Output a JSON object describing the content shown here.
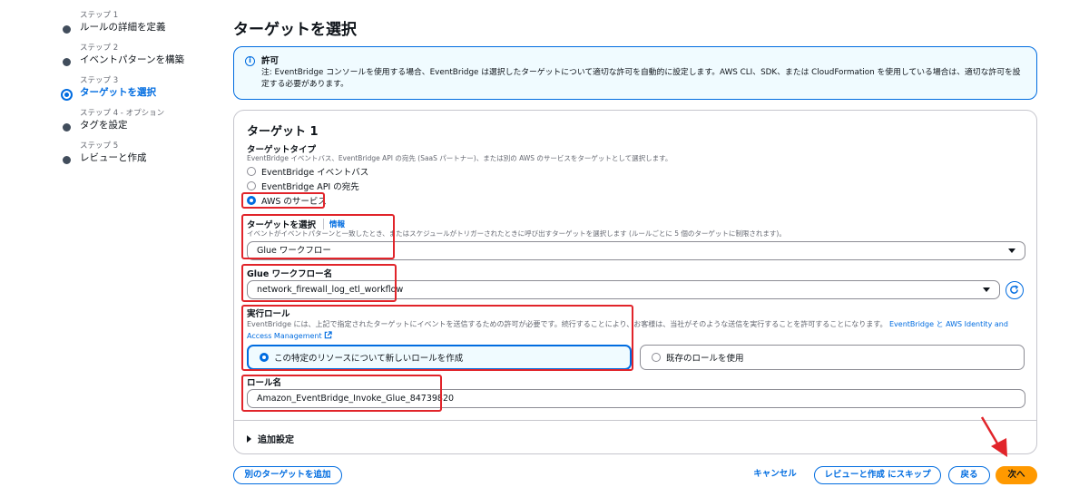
{
  "sidebar": {
    "steps": [
      {
        "label": "ステップ 1",
        "name": "ルールの詳細を定義"
      },
      {
        "label": "ステップ 2",
        "name": "イベントパターンを構築"
      },
      {
        "label": "ステップ 3",
        "name": "ターゲットを選択"
      },
      {
        "label": "ステップ 4 - オプション",
        "name": "タグを設定"
      },
      {
        "label": "ステップ 5",
        "name": "レビューと作成"
      }
    ]
  },
  "page_title": "ターゲットを選択",
  "alert": {
    "title": "許可",
    "body": "注: EventBridge コンソールを使用する場合、EventBridge は選択したターゲットについて適切な許可を自動的に設定します。AWS CLI、SDK、または CloudFormation を使用している場合は、適切な許可を設定する必要があります。"
  },
  "target": {
    "heading": "ターゲット 1",
    "type_label": "ターゲットタイプ",
    "type_desc": "EventBridge イベントバス、EventBridge API の宛先 (SaaS パートナー)、または別の AWS のサービスをターゲットとして選択します。",
    "type_options": [
      "EventBridge イベントバス",
      "EventBridge API の宛先",
      "AWS のサービス"
    ],
    "select_label": "ターゲットを選択",
    "info_link": "情報",
    "select_desc": "イベントがイベントパターンと一致したとき、またはスケジュールがトリガーされたときに呼び出すターゲットを選択します (ルールごとに 5 個のターゲットに制限されます)。",
    "select_value": "Glue ワークフロー",
    "workflow_label": "Glue ワークフロー名",
    "workflow_value": "network_firewall_log_etl_workflow",
    "role_label": "実行ロール",
    "role_desc": "EventBridge には、上記で指定されたターゲットにイベントを送信するための許可が必要です。続行することにより、お客様は、当社がそのような送信を実行することを許可することになります。",
    "role_link": "EventBridge と AWS Identity and Access Management",
    "role_option_new": "この特定のリソースについて新しいロールを作成",
    "role_option_existing": "既存のロールを使用",
    "role_name_label": "ロール名",
    "role_name_value": "Amazon_EventBridge_Invoke_Glue_84739820",
    "additional": "追加設定"
  },
  "footer": {
    "add_target": "別のターゲットを追加",
    "cancel": "キャンセル",
    "skip": "レビューと作成 にスキップ",
    "back": "戻る",
    "next": "次へ"
  },
  "colors": {
    "accent": "#006ce0",
    "primary_button": "#ff9900",
    "highlight": "#e1242a"
  }
}
